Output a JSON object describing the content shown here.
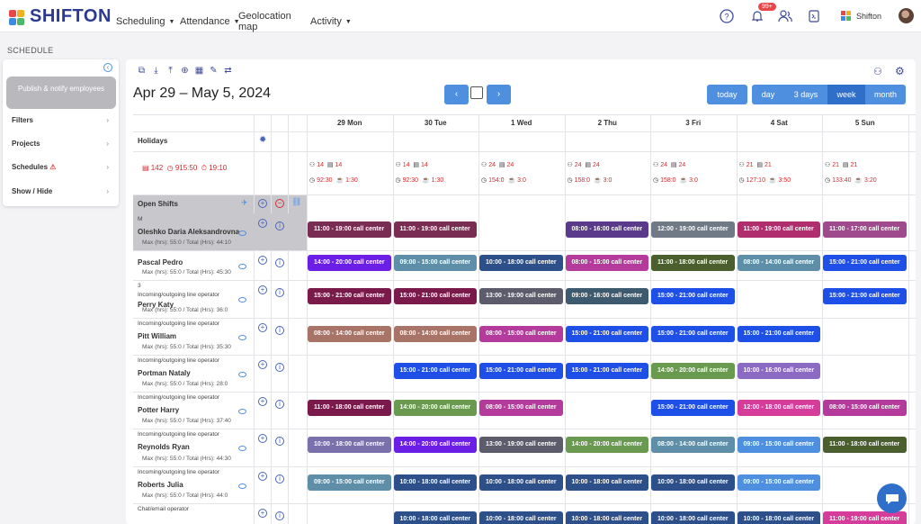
{
  "app": {
    "brand": "SHIFTON",
    "user_name": "Shifton",
    "notifications_badge": "99+"
  },
  "nav": [
    {
      "label": "Scheduling",
      "has_caret": true
    },
    {
      "label": "Attendance",
      "has_caret": true
    },
    {
      "label": "Geolocation map",
      "has_caret": false
    },
    {
      "label": "Activity",
      "has_caret": true
    }
  ],
  "page_title": "SCHEDULE",
  "sidebar": {
    "publish_label": "Publish & notify employees",
    "items": [
      {
        "label": "Filters"
      },
      {
        "label": "Projects"
      },
      {
        "label": "Schedules",
        "warning": true
      },
      {
        "label": "Show / Hide"
      }
    ]
  },
  "toolbar": {
    "date_range": "Apr 29 – May 5, 2024",
    "prev_label": "‹",
    "next_label": "›",
    "today_label": "today",
    "views": [
      {
        "label": "day"
      },
      {
        "label": "3 days"
      },
      {
        "label": "week",
        "active": true
      },
      {
        "label": "month"
      }
    ]
  },
  "days": [
    "29 Mon",
    "30 Tue",
    "1 Wed",
    "2 Thu",
    "3 Fri",
    "4 Sat",
    "5 Sun"
  ],
  "holidays_label": "Holidays",
  "totals": {
    "people": "142",
    "hours": "915:50",
    "cost": "19:10"
  },
  "day_stats": [
    {
      "people": "14",
      "shifts": "14",
      "hours": "92:30",
      "breaks": "1:30"
    },
    {
      "people": "14",
      "shifts": "14",
      "hours": "92:30",
      "breaks": "1:30"
    },
    {
      "people": "24",
      "shifts": "24",
      "hours": "154:0",
      "breaks": "3:0"
    },
    {
      "people": "24",
      "shifts": "24",
      "hours": "158:0",
      "breaks": "3:0"
    },
    {
      "people": "24",
      "shifts": "24",
      "hours": "158:0",
      "breaks": "3:0"
    },
    {
      "people": "21",
      "shifts": "21",
      "hours": "127:10",
      "breaks": "3:50"
    },
    {
      "people": "21",
      "shifts": "21",
      "hours": "133:40",
      "breaks": "3:20"
    }
  ],
  "open_shifts_label": "Open Shifts",
  "employees": [
    {
      "position": "M",
      "name": "Oleshko Daria Aleksandrovna",
      "meta": "Max (hrs): 55:0 / Total (Hrs): 44:10",
      "highlight": true,
      "shifts": [
        {
          "day": 0,
          "text": "11:00 - 19:00  call center",
          "color": "#7a2d52"
        },
        {
          "day": 1,
          "text": "11:00 - 19:00  call center",
          "color": "#7a2d52"
        },
        {
          "day": 3,
          "text": "08:00 - 16:00  call center",
          "color": "#5b3a8c"
        },
        {
          "day": 4,
          "text": "12:00 - 19:00  call center",
          "color": "#707a86"
        },
        {
          "day": 5,
          "text": "11:00 - 19:00  call center",
          "color": "#b02e6e"
        },
        {
          "day": 6,
          "text": "11:00 - 17:00  call center",
          "color": "#9e4a8c"
        }
      ]
    },
    {
      "position": "",
      "name": "Pascal Pedro",
      "meta": "Max (hrs): 55:0 / Total (Hrs): 45:30",
      "shifts": [
        {
          "day": 0,
          "text": "14:00 - 20:00  call center",
          "color": "#6a1ee6"
        },
        {
          "day": 1,
          "text": "09:00 - 15:00  call center",
          "color": "#5f8fa8"
        },
        {
          "day": 2,
          "text": "10:00 - 18:00  call center",
          "color": "#2d4f8a"
        },
        {
          "day": 3,
          "text": "08:00 - 15:00  call center",
          "color": "#b43a9c"
        },
        {
          "day": 4,
          "text": "11:00 - 18:00  call center",
          "color": "#4b5e2e"
        },
        {
          "day": 5,
          "text": "08:00 - 14:00  call center",
          "color": "#5f8fa8"
        },
        {
          "day": 6,
          "text": "15:00 - 21:00  call center",
          "color": "#1e4fe6"
        }
      ]
    },
    {
      "position": "3\nIncoming/outgoing line operator",
      "name": "Perry Katy",
      "meta": "Max (hrs): 55:0 / Total (Hrs): 36:0",
      "shifts": [
        {
          "day": 0,
          "text": "15:00 - 21:00  call center",
          "color": "#7a1a4a"
        },
        {
          "day": 1,
          "text": "15:00 - 21:00  call center",
          "color": "#7a1a4a"
        },
        {
          "day": 2,
          "text": "13:00 - 19:00  call center",
          "color": "#5c5c6c"
        },
        {
          "day": 3,
          "text": "09:00 - 16:00  call center",
          "color": "#3d5a6e"
        },
        {
          "day": 4,
          "text": "15:00 - 21:00  call center",
          "color": "#1e4fe6"
        },
        {
          "day": 6,
          "text": "15:00 - 21:00  call center",
          "color": "#1e4fe6"
        }
      ]
    },
    {
      "position": "Incoming/outgoing line operator",
      "name": "Pitt William",
      "meta": "Max (hrs): 55:0 / Total (Hrs): 35:30",
      "shifts": [
        {
          "day": 0,
          "text": "08:00 - 14:00  call center",
          "color": "#a87468"
        },
        {
          "day": 1,
          "text": "08:00 - 14:00  call center",
          "color": "#a87468"
        },
        {
          "day": 2,
          "text": "08:00 - 15:00  call center",
          "color": "#b43a9c"
        },
        {
          "day": 3,
          "text": "15:00 - 21:00  call center",
          "color": "#1e4fe6"
        },
        {
          "day": 4,
          "text": "15:00 - 21:00  call center",
          "color": "#1e4fe6"
        },
        {
          "day": 5,
          "text": "15:00 - 21:00  call center",
          "color": "#1e4fe6"
        }
      ]
    },
    {
      "position": "Incoming/outgoing line operator",
      "name": "Portman Nataly",
      "meta": "Max (hrs): 55:0 / Total (Hrs): 28:0",
      "shifts": [
        {
          "day": 1,
          "text": "15:00 - 21:00  call center",
          "color": "#1e4fe6"
        },
        {
          "day": 2,
          "text": "15:00 - 21:00  call center",
          "color": "#1e4fe6"
        },
        {
          "day": 3,
          "text": "15:00 - 21:00  call center",
          "color": "#1e4fe6"
        },
        {
          "day": 4,
          "text": "14:00 - 20:00  call center",
          "color": "#6a9a50"
        },
        {
          "day": 5,
          "text": "10:00 - 16:00  call center",
          "color": "#8a6ac2"
        }
      ]
    },
    {
      "position": "Incoming/outgoing line operator",
      "name": "Potter Harry",
      "meta": "Max (hrs): 55:0 / Total (Hrs): 37:40",
      "shifts": [
        {
          "day": 0,
          "text": "11:00 - 18:00  call center",
          "color": "#7a1a4a"
        },
        {
          "day": 1,
          "text": "14:00 - 20:00  call center",
          "color": "#6a9a50"
        },
        {
          "day": 2,
          "text": "08:00 - 15:00  call center",
          "color": "#b43a9c"
        },
        {
          "day": 4,
          "text": "15:00 - 21:00  call center",
          "color": "#1e4fe6"
        },
        {
          "day": 5,
          "text": "12:00 - 18:00  call center",
          "color": "#d63c9a"
        },
        {
          "day": 6,
          "text": "08:00 - 15:00  call center",
          "color": "#b43a9c"
        }
      ]
    },
    {
      "position": "Incoming/outgoing line operator",
      "name": "Reynolds Ryan",
      "meta": "Max (hrs): 55:0 / Total (Hrs): 44:30",
      "shifts": [
        {
          "day": 0,
          "text": "10:00 - 18:00  call center",
          "color": "#7a70ac"
        },
        {
          "day": 1,
          "text": "14:00 - 20:00  call center",
          "color": "#6a1ee6"
        },
        {
          "day": 2,
          "text": "13:00 - 19:00  call center",
          "color": "#5c5c6c"
        },
        {
          "day": 3,
          "text": "14:00 - 20:00  call center",
          "color": "#6a9a50"
        },
        {
          "day": 4,
          "text": "08:00 - 14:00  call center",
          "color": "#5f8fa8"
        },
        {
          "day": 5,
          "text": "09:00 - 15:00  call center",
          "color": "#4f8fe0"
        },
        {
          "day": 6,
          "text": "11:00 - 18:00  call center",
          "color": "#4b5e2e"
        }
      ]
    },
    {
      "position": "Incoming/outgoing line operator",
      "name": "Roberts Julia",
      "meta": "Max (hrs): 55:0 / Total (Hrs): 44:0",
      "shifts": [
        {
          "day": 0,
          "text": "09:00 - 15:00  call center",
          "color": "#5f8fa8"
        },
        {
          "day": 1,
          "text": "10:00 - 18:00  call center",
          "color": "#2d4f8a"
        },
        {
          "day": 2,
          "text": "10:00 - 18:00  call center",
          "color": "#2d4f8a"
        },
        {
          "day": 3,
          "text": "10:00 - 18:00  call center",
          "color": "#2d4f8a"
        },
        {
          "day": 4,
          "text": "10:00 - 18:00  call center",
          "color": "#2d4f8a"
        },
        {
          "day": 5,
          "text": "09:00 - 15:00  call center",
          "color": "#4f8fe0"
        }
      ]
    },
    {
      "position": "Chat/email operator",
      "name": "",
      "meta": "",
      "shifts": [
        {
          "day": 1,
          "text": "10:00 - 18:00  call center",
          "color": "#2d4f8a"
        },
        {
          "day": 2,
          "text": "10:00 - 18:00  call center",
          "color": "#2d4f8a"
        },
        {
          "day": 3,
          "text": "10:00 - 18:00  call center",
          "color": "#2d4f8a"
        },
        {
          "day": 4,
          "text": "10:00 - 18:00  call center",
          "color": "#2d4f8a"
        },
        {
          "day": 5,
          "text": "10:00 - 18:00  call center",
          "color": "#2d4f8a"
        },
        {
          "day": 6,
          "text": "11:00 - 19:00  call center",
          "color": "#d63c9a"
        }
      ]
    }
  ]
}
